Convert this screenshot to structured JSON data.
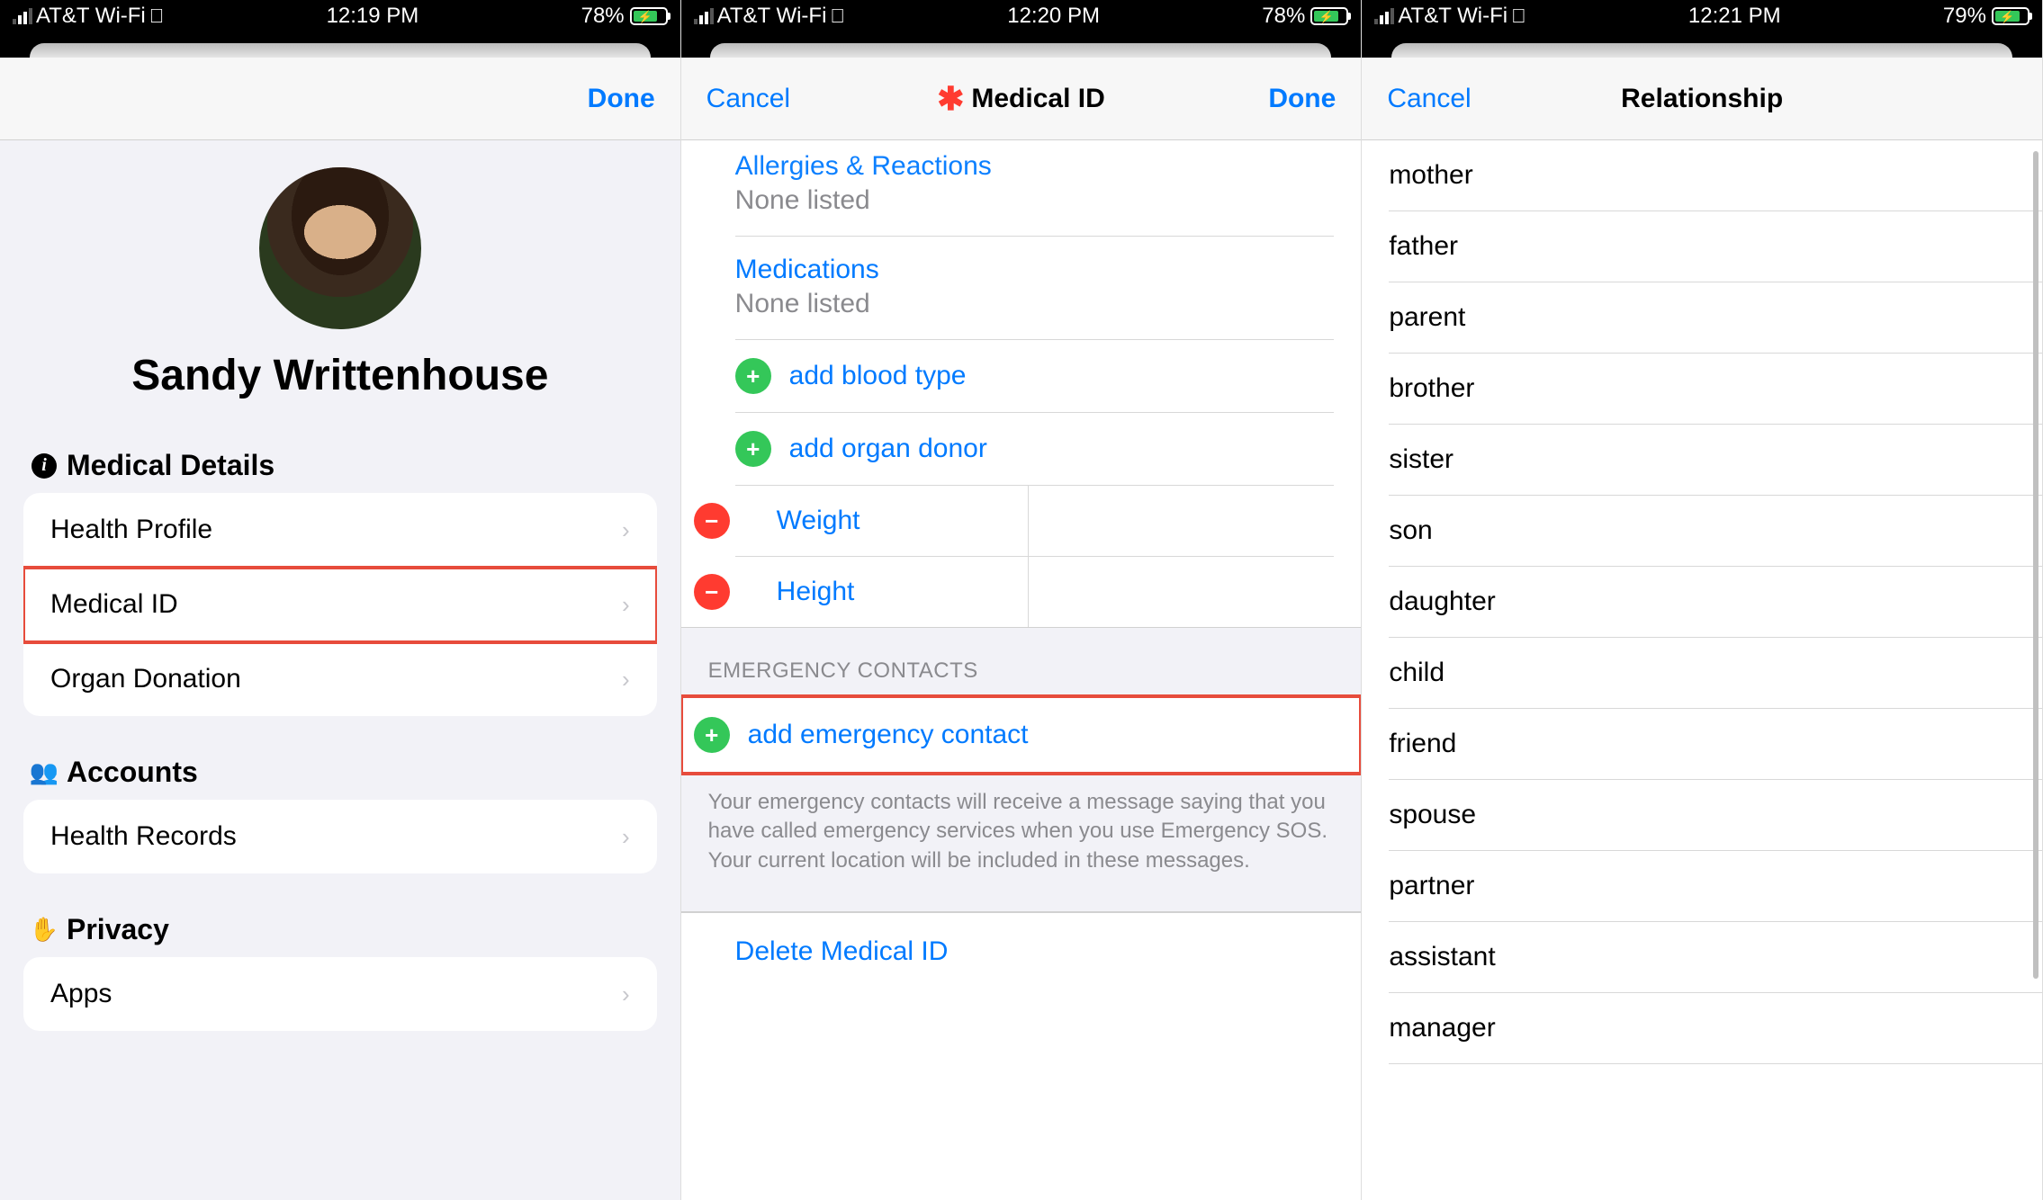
{
  "screens": [
    {
      "status": {
        "carrier": "AT&T Wi-Fi",
        "time": "12:19 PM",
        "battery_pct": "78%"
      },
      "nav": {
        "done": "Done"
      },
      "profile_name": "Sandy Writtenhouse",
      "sections": {
        "medical_details": {
          "header": "Medical Details",
          "items": [
            "Health Profile",
            "Medical ID",
            "Organ Donation"
          ]
        },
        "accounts": {
          "header": "Accounts",
          "items": [
            "Health Records"
          ]
        },
        "privacy": {
          "header": "Privacy",
          "items": [
            "Apps"
          ]
        }
      }
    },
    {
      "status": {
        "carrier": "AT&T Wi-Fi",
        "time": "12:20 PM",
        "battery_pct": "78%"
      },
      "nav": {
        "cancel": "Cancel",
        "title": "Medical ID",
        "done": "Done"
      },
      "fields": {
        "allergies_label": "Allergies & Reactions",
        "allergies_value": "None listed",
        "medications_label": "Medications",
        "medications_value": "None listed",
        "add_blood_type": "add blood type",
        "add_organ_donor": "add organ donor",
        "weight": "Weight",
        "height": "Height"
      },
      "emergency": {
        "header": "EMERGENCY CONTACTS",
        "add": "add emergency contact",
        "footer": "Your emergency contacts will receive a message saying that you have called emergency services when you use Emergency SOS. Your current location will be included in these messages."
      },
      "delete": "Delete Medical ID"
    },
    {
      "status": {
        "carrier": "AT&T Wi-Fi",
        "time": "12:21 PM",
        "battery_pct": "79%"
      },
      "nav": {
        "cancel": "Cancel",
        "title": "Relationship"
      },
      "relationships": [
        "mother",
        "father",
        "parent",
        "brother",
        "sister",
        "son",
        "daughter",
        "child",
        "friend",
        "spouse",
        "partner",
        "assistant",
        "manager"
      ]
    }
  ]
}
